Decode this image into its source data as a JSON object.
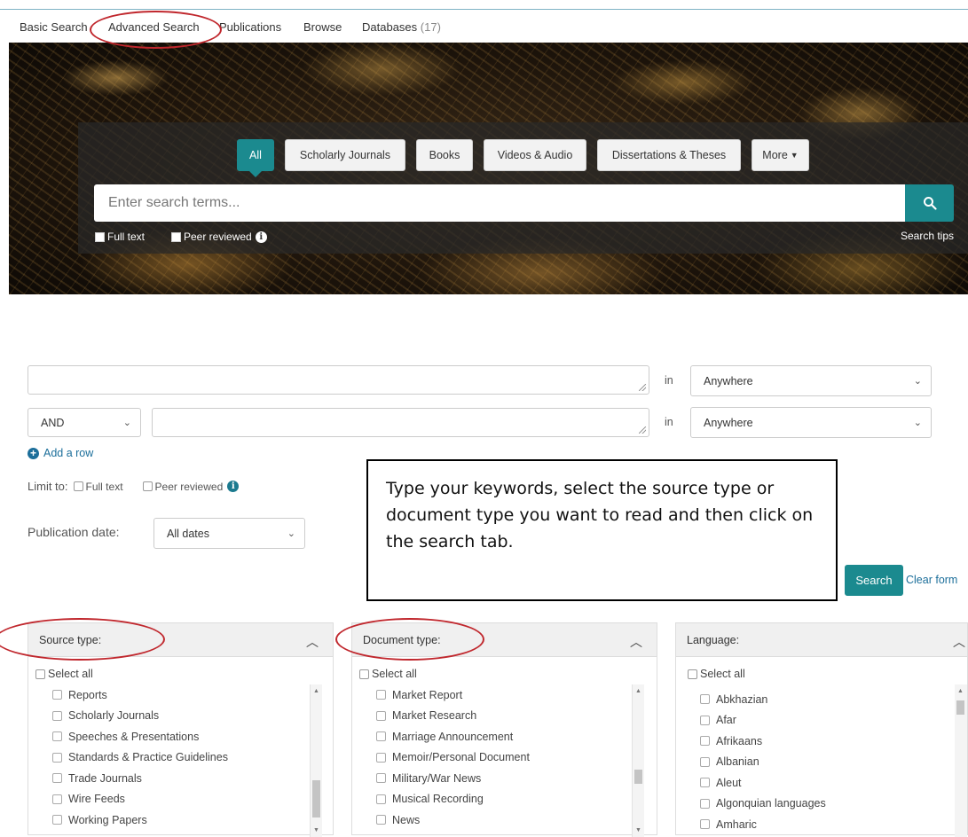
{
  "top_tabs": {
    "basic_search": "Basic Search",
    "advanced_search": "Advanced Search",
    "publications": "Publications",
    "browse": "Browse",
    "databases": "Databases",
    "databases_count": "(17)"
  },
  "hero": {
    "source_buttons": [
      "All",
      "Scholarly Journals",
      "Books",
      "Videos & Audio",
      "Dissertations & Theses",
      "More"
    ],
    "search_placeholder": "Enter search terms...",
    "full_text_label": "Full text",
    "peer_reviewed_label": "Peer reviewed",
    "search_tips": "Search tips"
  },
  "advanced": {
    "in_label": "in",
    "field_1": "Anywhere",
    "operator": "AND",
    "field_2": "Anywhere",
    "add_row": "Add a row",
    "limit_to": "Limit to:",
    "full_text": "Full text",
    "peer_reviewed": "Peer reviewed",
    "publication_date_label": "Publication date:",
    "publication_date_value": "All dates",
    "search_button": "Search",
    "clear_form": "Clear form"
  },
  "callout": {
    "text": "Type your keywords, select the source type or document type you want to read and then click on the search tab."
  },
  "panels": {
    "source_type": {
      "title": "Source type:",
      "select_all": "Select all",
      "items": [
        "Reports",
        "Scholarly Journals",
        "Speeches & Presentations",
        "Standards & Practice Guidelines",
        "Trade Journals",
        "Wire Feeds",
        "Working Papers"
      ]
    },
    "document_type": {
      "title": "Document type:",
      "select_all": "Select all",
      "items": [
        "Market Report",
        "Market Research",
        "Marriage Announcement",
        "Memoir/Personal Document",
        "Military/War News",
        "Musical Recording",
        "News"
      ]
    },
    "language": {
      "title": "Language:",
      "select_all": "Select all",
      "items": [
        "Abkhazian",
        "Afar",
        "Afrikaans",
        "Albanian",
        "Aleut",
        "Algonquian languages",
        "Amharic"
      ]
    }
  },
  "colors": {
    "accent": "#1b8a8f",
    "link": "#1b6e9a",
    "annotation": "#c0272d"
  }
}
